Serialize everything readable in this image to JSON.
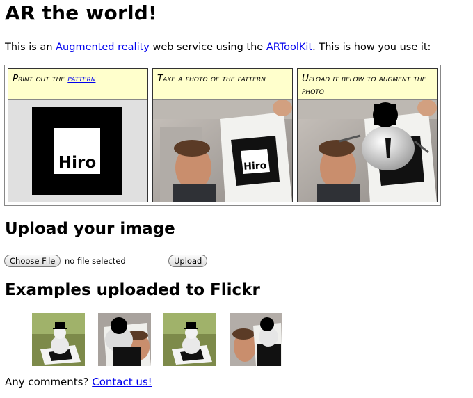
{
  "page": {
    "title": "AR the world!"
  },
  "intro": {
    "text_before": "This is an ",
    "link1": "Augmented reality",
    "text_middle": " web service using the ",
    "link2": "ARToolKit",
    "text_after": ". This is how you use it:"
  },
  "steps": [
    {
      "caption_before": "Print out the ",
      "caption_link": "pattern",
      "image": "hiro-marker",
      "marker_text": "Hiro"
    },
    {
      "caption": "Take a photo of the pattern",
      "image": "photo-person-holding-marker",
      "marker_text": "Hiro"
    },
    {
      "caption": "Upload it below to augment the photo",
      "image": "photo-augmented-snowman"
    }
  ],
  "upload": {
    "heading": "Upload your image",
    "choose_label": "Choose File",
    "no_file_text": "no file selected",
    "upload_label": "Upload"
  },
  "examples": {
    "heading": "Examples uploaded to Flickr",
    "thumbnails": [
      "snowman-on-desk",
      "augmented-face-photo",
      "snowman-on-desk",
      "augmented-face-photo"
    ]
  },
  "comments": {
    "text": "Any comments? ",
    "link": "Contact us!"
  }
}
